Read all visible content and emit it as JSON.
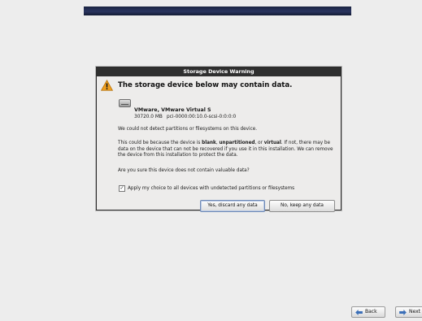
{
  "dialog": {
    "title": "Storage Device Warning",
    "heading": "The storage device below may contain data.",
    "device": {
      "name": "VMware, VMware Virtual S",
      "size": "30720.0 MB",
      "path": "pci-0000:00:10.0-scsi-0:0:0:0"
    },
    "no_detect_text": "We could not detect partitions or filesystems on this device.",
    "reason": {
      "part1": "This could be because the device is ",
      "blank": "blank",
      "sep1": ", ",
      "unpartitioned": "unpartitioned",
      "sep2": ", or ",
      "virtual": "virtual",
      "rest": ". If not, there may be data on the device that can not be recovered if you use it in this installation. We can remove the device from this installation to protect the data."
    },
    "are_you_sure": "Are you sure this device does not contain valuable data?",
    "apply_checkbox": {
      "label": "Apply my choice to all devices with undetected partitions or filesystems",
      "checked": true,
      "mark": "✓"
    },
    "buttons": {
      "discard": "Yes, discard any data",
      "keep": "No, keep any data"
    }
  },
  "nav": {
    "back": "Back",
    "next": "Next"
  },
  "colors": {
    "banner": "#1a2340",
    "titlebar": "#2f2f2f",
    "warning": "#f0a020",
    "nav_arrow": "#3b6fb8"
  },
  "icons": {
    "warning": "warning-icon",
    "disk": "hard-disk-icon",
    "back": "arrow-left-icon",
    "next": "arrow-right-icon"
  }
}
